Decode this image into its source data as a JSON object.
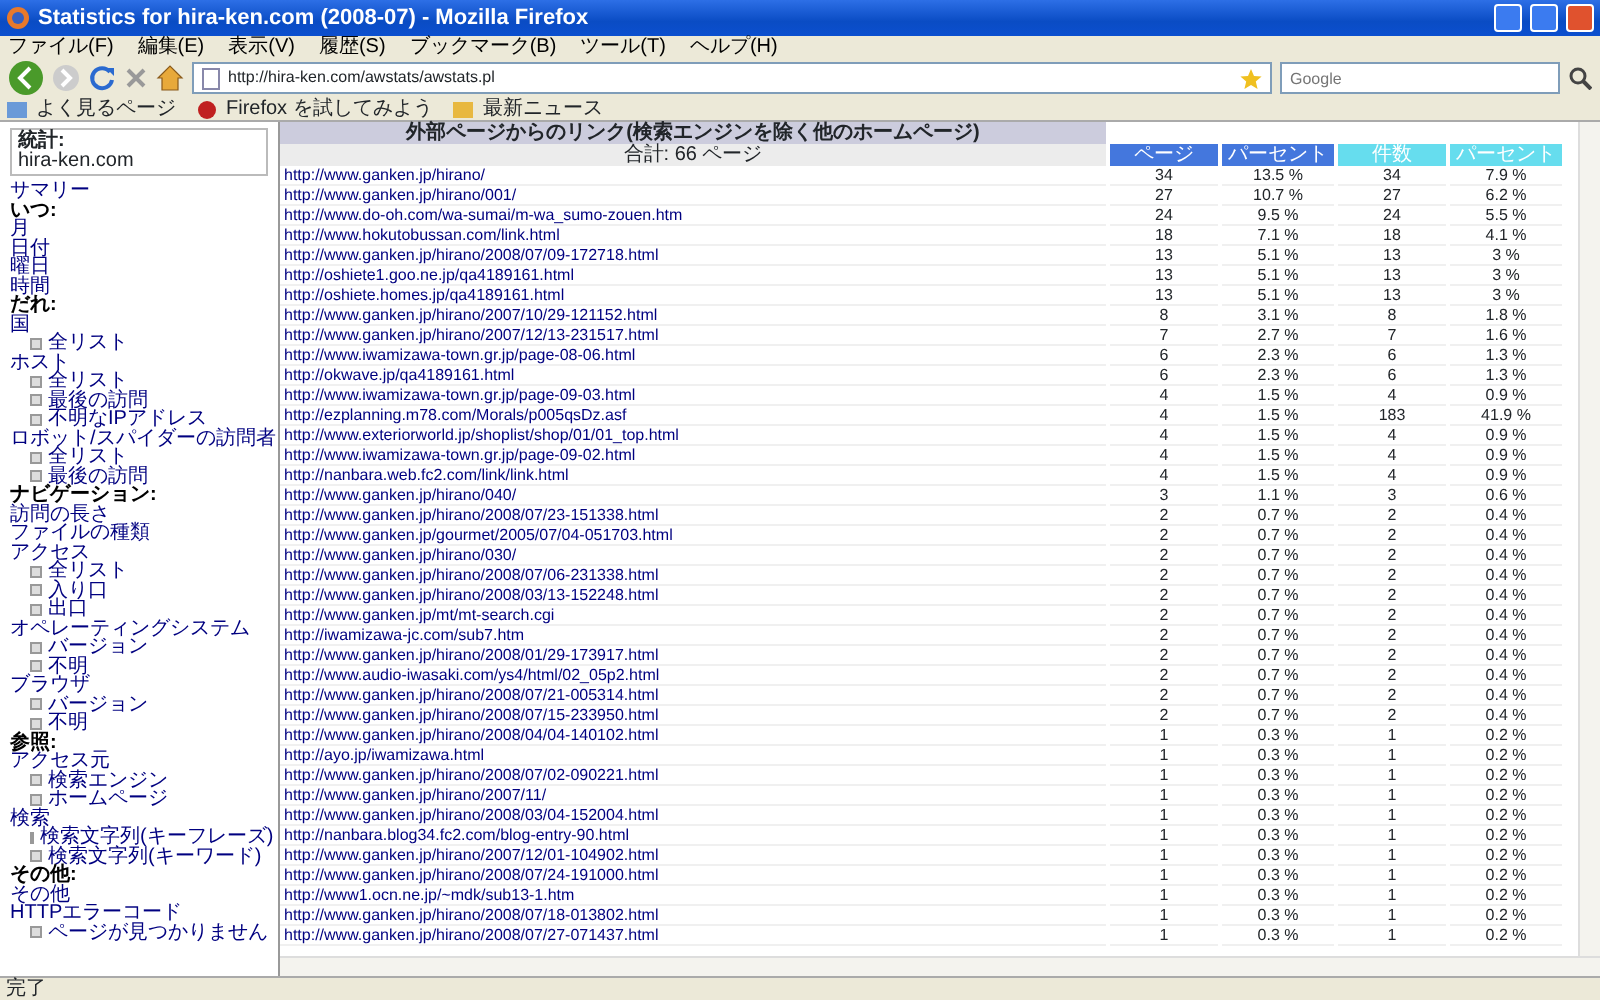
{
  "window": {
    "title": "Statistics for hira-ken.com (2008-07) - Mozilla Firefox"
  },
  "menu": [
    "ファイル(F)",
    "編集(E)",
    "表示(V)",
    "履歴(S)",
    "ブックマーク(B)",
    "ツール(T)",
    "ヘルプ(H)"
  ],
  "address_bar": {
    "url": "http://hira-ken.com/awstats/awstats.pl"
  },
  "search_field": {
    "placeholder": "Google"
  },
  "bookmarks": [
    "よく見るページ",
    "Firefox を試してみよう",
    "最新ニュース"
  ],
  "sidebar": {
    "stats_label": "統計:",
    "site": "hira-ken.com",
    "items": [
      {
        "label": "サマリー",
        "kind": "link"
      },
      {
        "label": "いつ:",
        "kind": "heading"
      },
      {
        "label": "月",
        "kind": "link"
      },
      {
        "label": "日付",
        "kind": "link"
      },
      {
        "label": "曜日",
        "kind": "link"
      },
      {
        "label": "時間",
        "kind": "link"
      },
      {
        "label": "だれ:",
        "kind": "heading"
      },
      {
        "label": "国",
        "kind": "link"
      },
      {
        "label": "全リスト",
        "kind": "sub"
      },
      {
        "label": "ホスト",
        "kind": "link"
      },
      {
        "label": "全リスト",
        "kind": "sub"
      },
      {
        "label": "最後の訪問",
        "kind": "sub"
      },
      {
        "label": "不明なIPアドレス",
        "kind": "sub"
      },
      {
        "label": "ロボット/スパイダーの訪問者",
        "kind": "link"
      },
      {
        "label": "全リスト",
        "kind": "sub"
      },
      {
        "label": "最後の訪問",
        "kind": "sub"
      },
      {
        "label": "ナビゲーション:",
        "kind": "heading"
      },
      {
        "label": "訪問の長さ",
        "kind": "link"
      },
      {
        "label": "ファイルの種類",
        "kind": "link"
      },
      {
        "label": "アクセス",
        "kind": "link"
      },
      {
        "label": "全リスト",
        "kind": "sub"
      },
      {
        "label": "入り口",
        "kind": "sub"
      },
      {
        "label": "出口",
        "kind": "sub"
      },
      {
        "label": "オペレーティングシステム",
        "kind": "link"
      },
      {
        "label": "バージョン",
        "kind": "sub"
      },
      {
        "label": "不明",
        "kind": "sub"
      },
      {
        "label": "ブラウザ",
        "kind": "link"
      },
      {
        "label": "バージョン",
        "kind": "sub"
      },
      {
        "label": "不明",
        "kind": "sub"
      },
      {
        "label": "参照:",
        "kind": "heading"
      },
      {
        "label": "アクセス元",
        "kind": "link"
      },
      {
        "label": "検索エンジン",
        "kind": "sub"
      },
      {
        "label": "ホームページ",
        "kind": "sub"
      },
      {
        "label": "検索",
        "kind": "link"
      },
      {
        "label": "検索文字列(キーフレーズ)",
        "kind": "sub"
      },
      {
        "label": "検索文字列(キーワード)",
        "kind": "sub"
      },
      {
        "label": "その他:",
        "kind": "heading"
      },
      {
        "label": "その他",
        "kind": "link"
      },
      {
        "label": "HTTPエラーコード",
        "kind": "link"
      },
      {
        "label": "ページが見つかりません",
        "kind": "sub"
      }
    ]
  },
  "table": {
    "title": "外部ページからのリンク(検索エンジンを除く他のホームページ)",
    "columns": [
      {
        "label": "合計: 66 ページ"
      },
      {
        "label": "ページ",
        "color": "#4477dd"
      },
      {
        "label": "パーセント",
        "color": "#4477dd"
      },
      {
        "label": "件数",
        "color": "#66ddee"
      },
      {
        "label": "パーセント",
        "color": "#66ddee"
      }
    ],
    "rows": [
      [
        "http://www.ganken.jp/hirano/",
        "34",
        "13.5 %",
        "34",
        "7.9 %"
      ],
      [
        "http://www.ganken.jp/hirano/001/",
        "27",
        "10.7 %",
        "27",
        "6.2 %"
      ],
      [
        "http://www.do-oh.com/wa-sumai/m-wa_sumo-zouen.htm",
        "24",
        "9.5 %",
        "24",
        "5.5 %"
      ],
      [
        "http://www.hokutobussan.com/link.html",
        "18",
        "7.1 %",
        "18",
        "4.1 %"
      ],
      [
        "http://www.ganken.jp/hirano/2008/07/09-172718.html",
        "13",
        "5.1 %",
        "13",
        "3 %"
      ],
      [
        "http://oshiete1.goo.ne.jp/qa4189161.html",
        "13",
        "5.1 %",
        "13",
        "3 %"
      ],
      [
        "http://oshiete.homes.jp/qa4189161.html",
        "13",
        "5.1 %",
        "13",
        "3 %"
      ],
      [
        "http://www.ganken.jp/hirano/2007/10/29-121152.html",
        "8",
        "3.1 %",
        "8",
        "1.8 %"
      ],
      [
        "http://www.ganken.jp/hirano/2007/12/13-231517.html",
        "7",
        "2.7 %",
        "7",
        "1.6 %"
      ],
      [
        "http://www.iwamizawa-town.gr.jp/page-08-06.html",
        "6",
        "2.3 %",
        "6",
        "1.3 %"
      ],
      [
        "http://okwave.jp/qa4189161.html",
        "6",
        "2.3 %",
        "6",
        "1.3 %"
      ],
      [
        "http://www.iwamizawa-town.gr.jp/page-09-03.html",
        "4",
        "1.5 %",
        "4",
        "0.9 %"
      ],
      [
        "http://ezplanning.m78.com/Morals/p005qsDz.asf",
        "4",
        "1.5 %",
        "183",
        "41.9 %"
      ],
      [
        "http://www.exteriorworld.jp/shoplist/shop/01/01_top.html",
        "4",
        "1.5 %",
        "4",
        "0.9 %"
      ],
      [
        "http://www.iwamizawa-town.gr.jp/page-09-02.html",
        "4",
        "1.5 %",
        "4",
        "0.9 %"
      ],
      [
        "http://nanbara.web.fc2.com/link/link.html",
        "4",
        "1.5 %",
        "4",
        "0.9 %"
      ],
      [
        "http://www.ganken.jp/hirano/040/",
        "3",
        "1.1 %",
        "3",
        "0.6 %"
      ],
      [
        "http://www.ganken.jp/hirano/2008/07/23-151338.html",
        "2",
        "0.7 %",
        "2",
        "0.4 %"
      ],
      [
        "http://www.ganken.jp/gourmet/2005/07/04-051703.html",
        "2",
        "0.7 %",
        "2",
        "0.4 %"
      ],
      [
        "http://www.ganken.jp/hirano/030/",
        "2",
        "0.7 %",
        "2",
        "0.4 %"
      ],
      [
        "http://www.ganken.jp/hirano/2008/07/06-231338.html",
        "2",
        "0.7 %",
        "2",
        "0.4 %"
      ],
      [
        "http://www.ganken.jp/hirano/2008/03/13-152248.html",
        "2",
        "0.7 %",
        "2",
        "0.4 %"
      ],
      [
        "http://www.ganken.jp/mt/mt-search.cgi",
        "2",
        "0.7 %",
        "2",
        "0.4 %"
      ],
      [
        "http://iwamizawa-jc.com/sub7.htm",
        "2",
        "0.7 %",
        "2",
        "0.4 %"
      ],
      [
        "http://www.ganken.jp/hirano/2008/01/29-173917.html",
        "2",
        "0.7 %",
        "2",
        "0.4 %"
      ],
      [
        "http://www.audio-iwasaki.com/ys4/html/02_05p2.html",
        "2",
        "0.7 %",
        "2",
        "0.4 %"
      ],
      [
        "http://www.ganken.jp/hirano/2008/07/21-005314.html",
        "2",
        "0.7 %",
        "2",
        "0.4 %"
      ],
      [
        "http://www.ganken.jp/hirano/2008/07/15-233950.html",
        "2",
        "0.7 %",
        "2",
        "0.4 %"
      ],
      [
        "http://www.ganken.jp/hirano/2008/04/04-140102.html",
        "1",
        "0.3 %",
        "1",
        "0.2 %"
      ],
      [
        "http://ayo.jp/iwamizawa.html",
        "1",
        "0.3 %",
        "1",
        "0.2 %"
      ],
      [
        "http://www.ganken.jp/hirano/2008/07/02-090221.html",
        "1",
        "0.3 %",
        "1",
        "0.2 %"
      ],
      [
        "http://www.ganken.jp/hirano/2007/11/",
        "1",
        "0.3 %",
        "1",
        "0.2 %"
      ],
      [
        "http://www.ganken.jp/hirano/2008/03/04-152004.html",
        "1",
        "0.3 %",
        "1",
        "0.2 %"
      ],
      [
        "http://nanbara.blog34.fc2.com/blog-entry-90.html",
        "1",
        "0.3 %",
        "1",
        "0.2 %"
      ],
      [
        "http://www.ganken.jp/hirano/2007/12/01-104902.html",
        "1",
        "0.3 %",
        "1",
        "0.2 %"
      ],
      [
        "http://www.ganken.jp/hirano/2008/07/24-191000.html",
        "1",
        "0.3 %",
        "1",
        "0.2 %"
      ],
      [
        "http://www1.ocn.ne.jp/~mdk/sub13-1.htm",
        "1",
        "0.3 %",
        "1",
        "0.2 %"
      ],
      [
        "http://www.ganken.jp/hirano/2008/07/18-013802.html",
        "1",
        "0.3 %",
        "1",
        "0.2 %"
      ],
      [
        "http://www.ganken.jp/hirano/2008/07/27-071437.html",
        "1",
        "0.3 %",
        "1",
        "0.2 %"
      ]
    ]
  },
  "status_bar": "完了"
}
